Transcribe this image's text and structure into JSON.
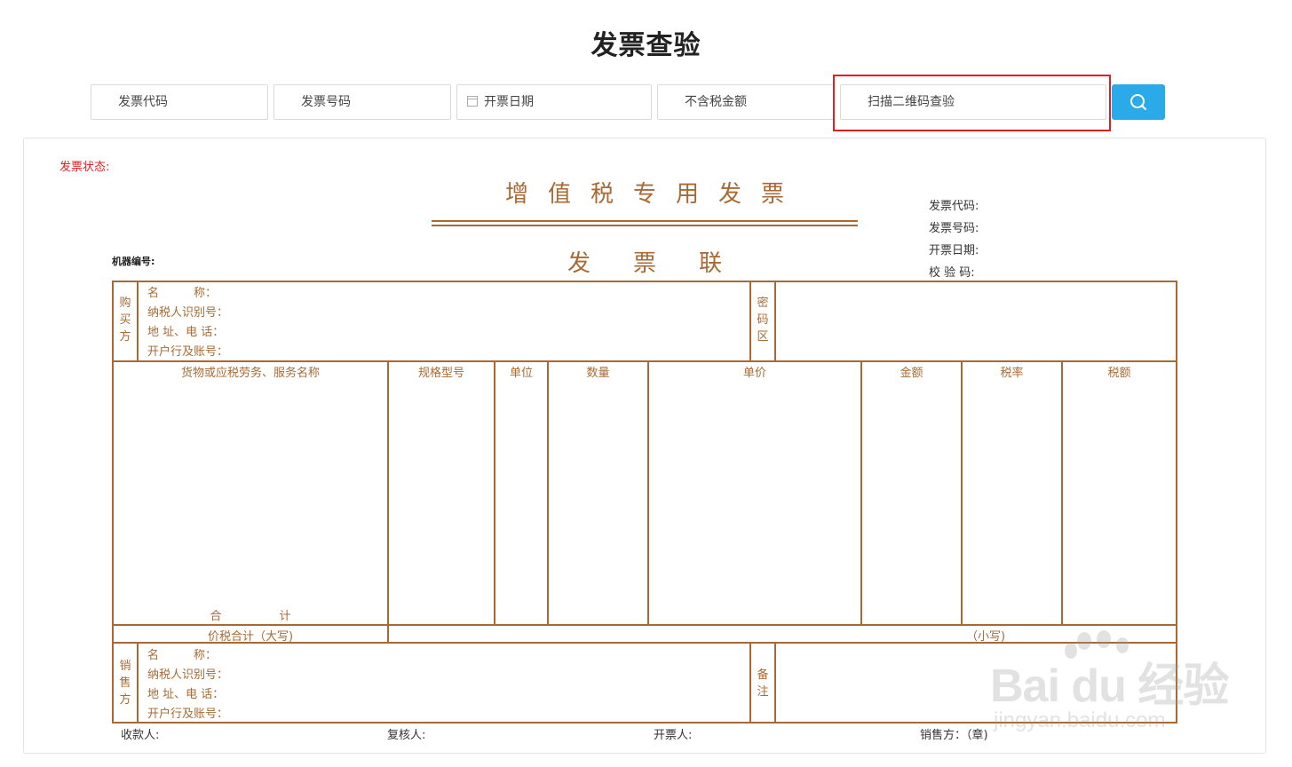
{
  "page": {
    "title": "发票查验"
  },
  "search": {
    "invoice_code_placeholder": "发票代码",
    "invoice_number_placeholder": "发票号码",
    "issue_date_placeholder": "开票日期",
    "amount_placeholder": "不含税金额",
    "qr_scan_placeholder": "扫描二维码查验",
    "button_icon": "search-icon",
    "highlight_color": "#e02020",
    "button_color": "#2aaae8"
  },
  "invoice": {
    "status_label": "发票状态:",
    "title": "增值税专用发票",
    "subtitle": "发票联",
    "machine_no_label": "机器编号:",
    "meta": {
      "code_label": "发票代码:",
      "number_label": "发票号码:",
      "date_label": "开票日期:",
      "check_code_label": "校 验 码:"
    },
    "buyer": {
      "side_label": [
        "购",
        "买",
        "方"
      ],
      "name_label": "名　　　称：",
      "tax_id_label": "纳税人识别号：",
      "address_label": "地 址、电 话：",
      "bank_label": "开户行及账号："
    },
    "cipher_label": [
      "密",
      "码",
      "区"
    ],
    "columns": [
      "货物或应税劳务、服务名称",
      "规格型号",
      "单位",
      "数量",
      "单价",
      "金额",
      "税率",
      "税额"
    ],
    "total_label": "合　　　　　计",
    "total_tax_label": "价税合计（大写)",
    "small_label": "（小写)",
    "seller": {
      "side_label": [
        "销",
        "售",
        "方"
      ],
      "name_label": "名　　　称：",
      "tax_id_label": "纳税人识别号：",
      "address_label": "地 址、电 话：",
      "bank_label": "开户行及账号："
    },
    "remark_label": [
      "备",
      "注"
    ],
    "footer": {
      "payee_label": "收款人:",
      "reviewer_label": "复核人:",
      "issuer_label": "开票人:",
      "seller_label": "销售方：（章)"
    },
    "accent_color": "#a86a34"
  },
  "watermark": {
    "logo": "Bai du 经验",
    "url": "jingyan.baidu.com"
  }
}
